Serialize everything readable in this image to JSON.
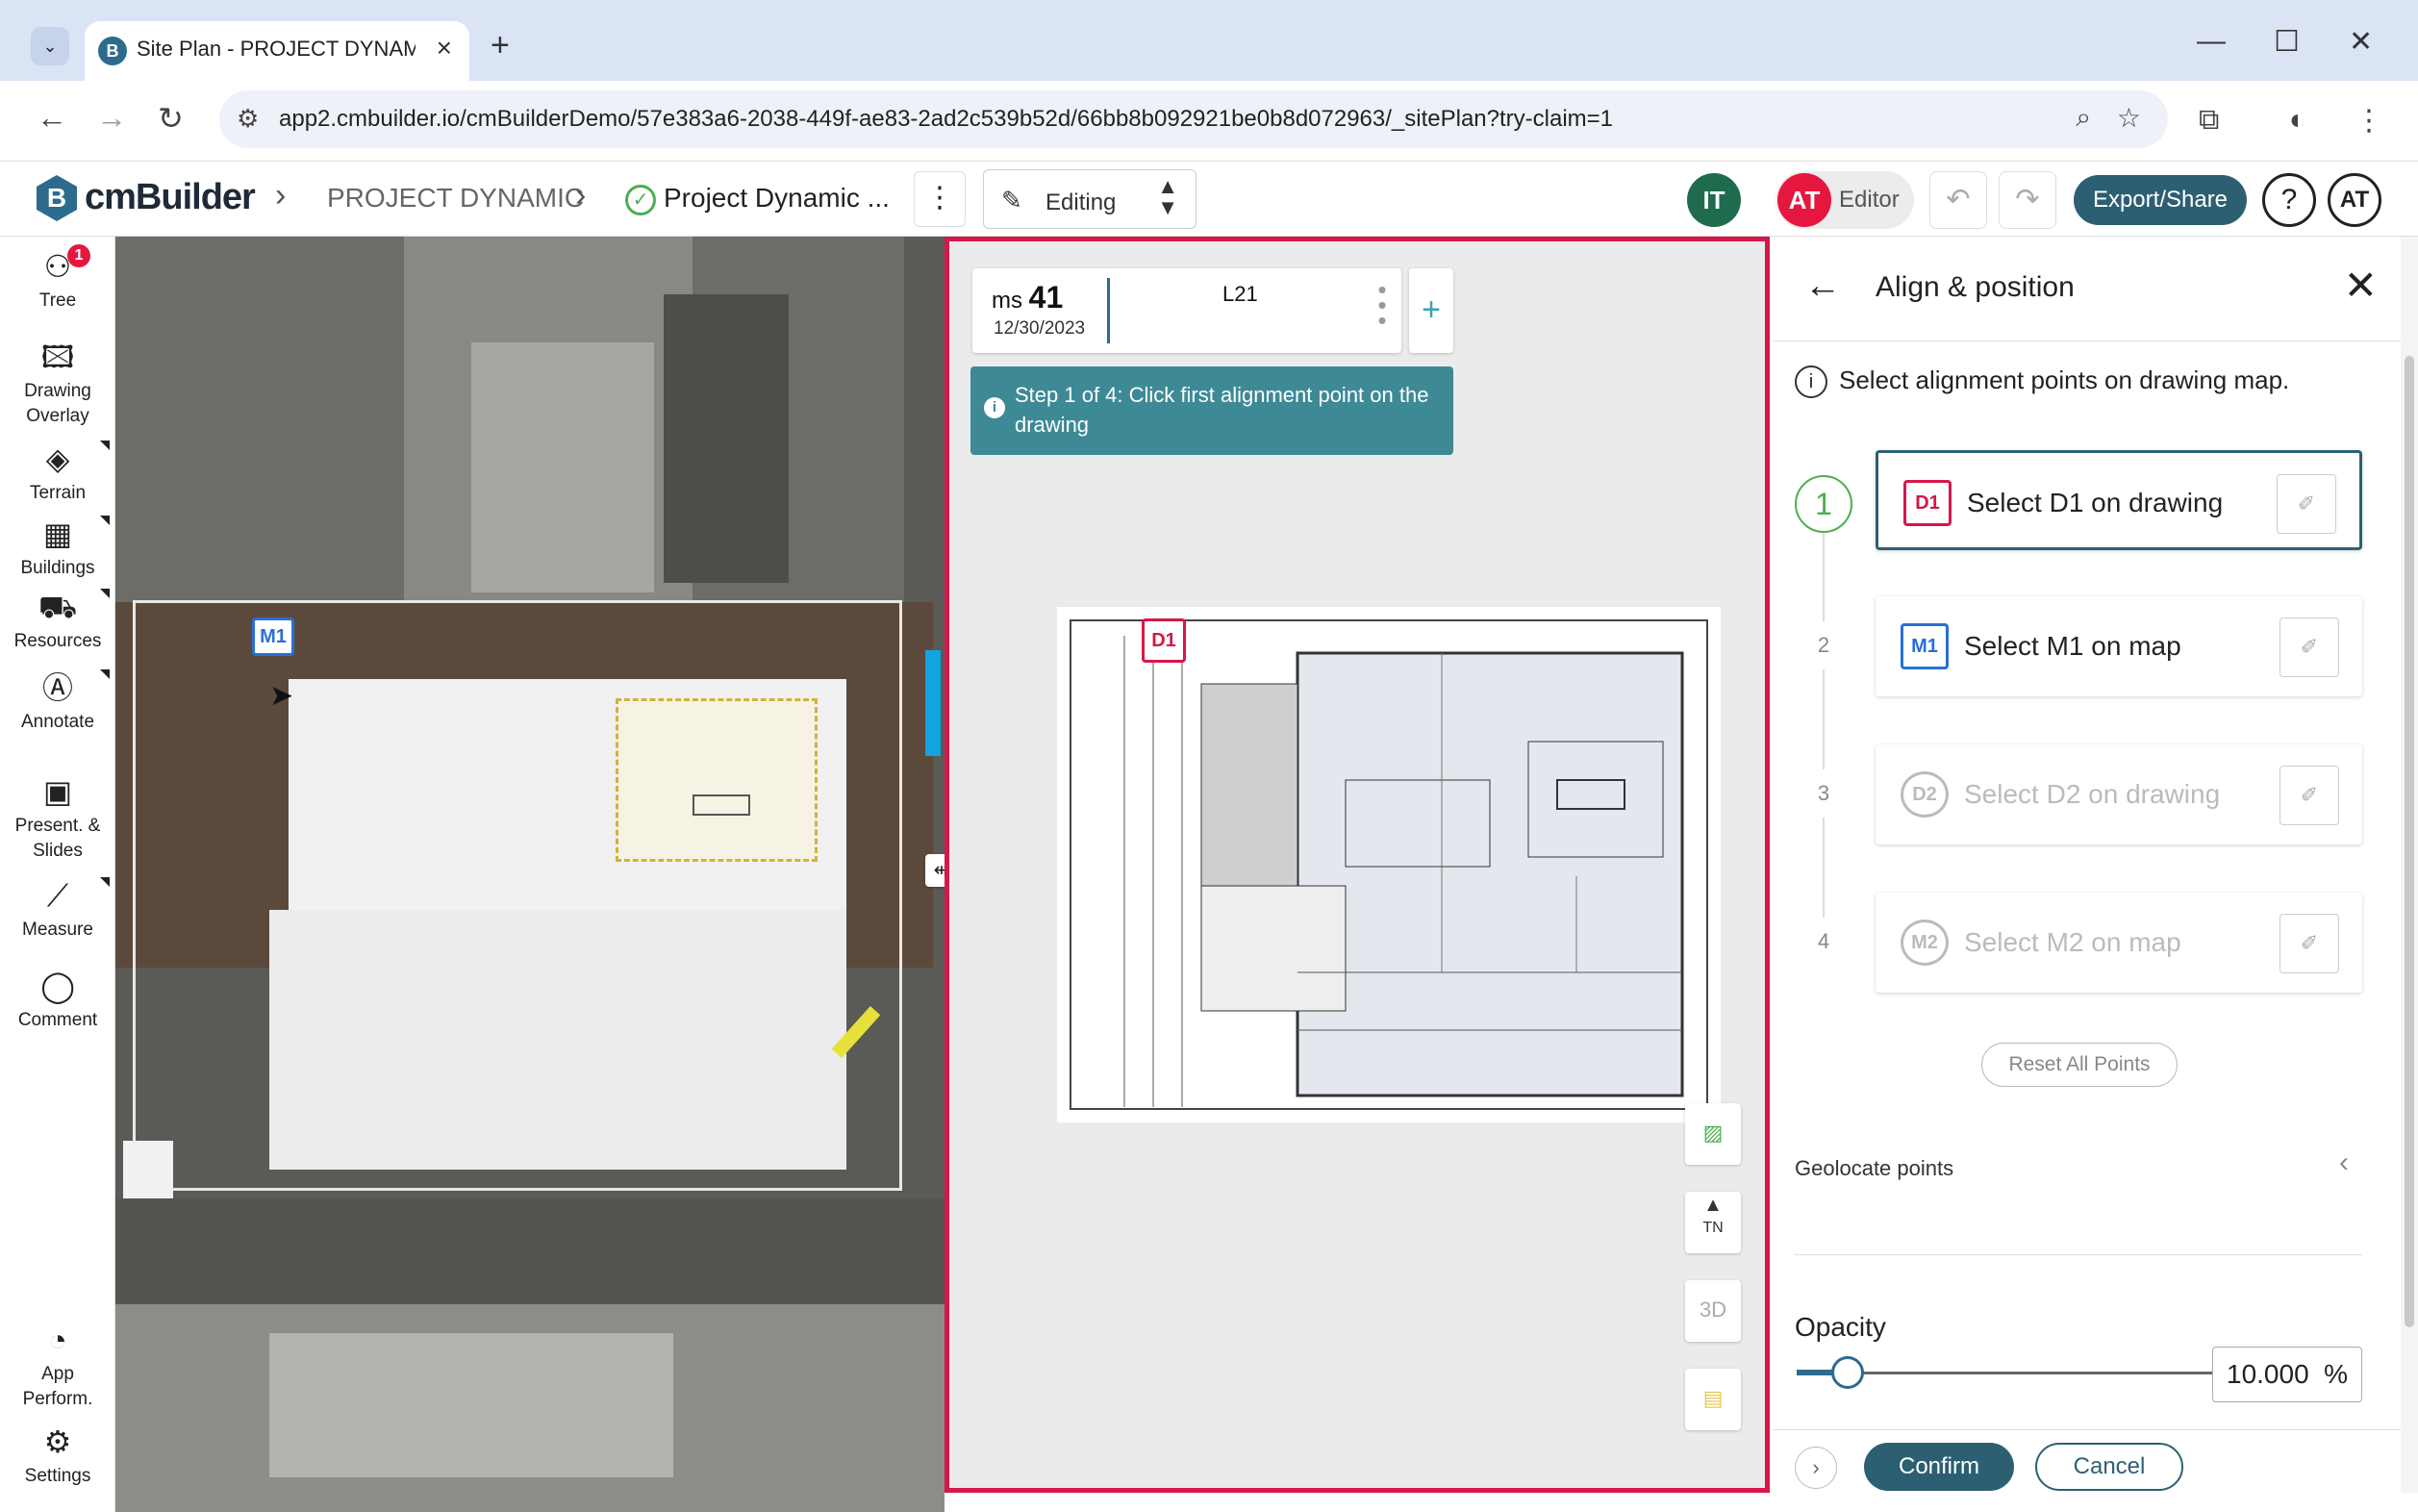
{
  "browser": {
    "tab_title": "Site Plan - PROJECT DYNAMIC |",
    "tab_favicon": "B",
    "url": "app2.cmbuilder.io/cmBuilderDemo/57e383a6-2038-449f-ae83-2ad2c539b52d/66bb8b092921be0b8d072963/_sitePlan?try-claim=1"
  },
  "header": {
    "logo_text": "cmBuilder",
    "logo_mark": "B",
    "breadcrumb_project": "PROJECT DYNAMIC",
    "breadcrumb_model": "Project Dynamic ...",
    "mode_label": "Editing",
    "user_it": "IT",
    "user_at": "AT",
    "role_label": "Editor",
    "export_label": "Export/Share",
    "help_label": "?",
    "profile_label": "AT"
  },
  "toolbar": {
    "tree_label": "Tree",
    "tree_badge": "1",
    "drawing_overlay_label_1": "Drawing",
    "drawing_overlay_label_2": "Overlay",
    "terrain_label": "Terrain",
    "buildings_label": "Buildings",
    "resources_label": "Resources",
    "annotate_label": "Annotate",
    "present_label_1": "Present. &",
    "present_label_2": "Slides",
    "measure_label": "Measure",
    "comment_label": "Comment",
    "perf_label_1": "App",
    "perf_label_2": "Perform.",
    "settings_label": "Settings"
  },
  "map": {
    "marker_m1": "M1"
  },
  "drawing_panel": {
    "ms_prefix": "ms",
    "ms_number": "41",
    "ms_date": "12/30/2023",
    "level": "L21",
    "step_banner": "Step 1 of 4: Click first alignment point on the drawing",
    "marker_d1": "D1",
    "ctl_tn": "TN",
    "ctl_3d": "3D"
  },
  "align_panel": {
    "title": "Align & position",
    "info": "Select alignment points on drawing map.",
    "steps": [
      {
        "num": "1",
        "tag": "D1",
        "label": "Select D1 on drawing",
        "active": true
      },
      {
        "num": "2",
        "tag": "M1",
        "label": "Select M1 on map",
        "active": false
      },
      {
        "num": "3",
        "tag": "D2",
        "label": "Select D2 on drawing",
        "active": false
      },
      {
        "num": "4",
        "tag": "M2",
        "label": "Select M2 on map",
        "active": false
      }
    ],
    "reset_label": "Reset All Points",
    "geolocate_label": "Geolocate points",
    "opacity_label": "Opacity",
    "opacity_value": "10.000",
    "opacity_fraction": 0.1,
    "opacity_unit": "%",
    "confirm_label": "Confirm",
    "cancel_label": "Cancel"
  },
  "colors": {
    "accent": "#2d5f73",
    "drawing_border": "#d6174a",
    "banner": "#3d8a96",
    "step_active": "#4caf50",
    "map_marker": "#2a6fd6"
  },
  "icons": [
    "back-icon",
    "forward-icon",
    "reload-icon",
    "site-settings-icon",
    "zoom-icon",
    "bookmark-star-icon",
    "extensions-icon",
    "tree-icon",
    "layers-icon",
    "terrain-icon",
    "buildings-icon",
    "resources-icon",
    "annotate-icon",
    "present-icon",
    "measure-icon",
    "comment-icon",
    "performance-icon",
    "settings-icon",
    "pencil-icon",
    "undo-icon",
    "redo-icon",
    "info-icon",
    "close-icon",
    "arrow-left-icon",
    "pin-icon"
  ]
}
